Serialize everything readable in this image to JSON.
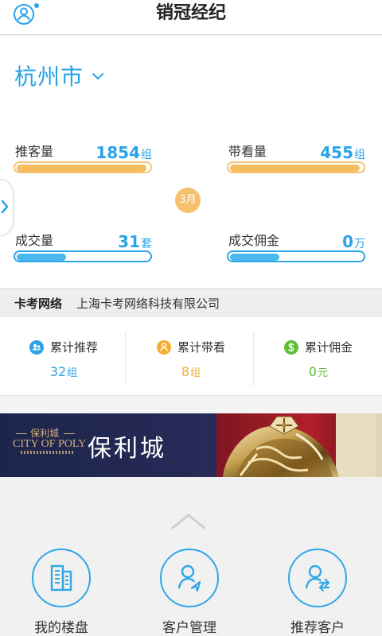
{
  "header": {
    "title": "销冠经纪",
    "profile_icon": "profile-icon",
    "notification_dot_color": "#29a3e8"
  },
  "location": {
    "city": "杭州市",
    "chevron_icon": "chevron-down-icon"
  },
  "stats": [
    {
      "label": "推客量",
      "value": "1854",
      "unit": "组",
      "color": "#f5bd5d",
      "fill_percent": 98
    },
    {
      "label": "带看量",
      "value": "455",
      "unit": "组",
      "color": "#f5bd5d",
      "fill_percent": 98
    },
    {
      "label": "成交量",
      "value": "31",
      "unit": "套",
      "color": "#49b8ee",
      "fill_percent": 39
    },
    {
      "label": "成交佣金",
      "value": "0",
      "unit": "万",
      "color": "#49b8ee",
      "fill_percent": 39
    }
  ],
  "period": {
    "label": "3月"
  },
  "company": {
    "short_name": "卡考网络",
    "full_name": "上海卡考网络科技有限公司"
  },
  "totals": [
    {
      "label": "累计推荐",
      "value": "32",
      "unit": "组",
      "color": "#29a3e8",
      "icon": "referral-icon"
    },
    {
      "label": "累计带看",
      "value": "8",
      "unit": "组",
      "color": "#f5ad2c",
      "icon": "viewing-icon"
    },
    {
      "label": "累计佣金",
      "value": "0",
      "unit": "元",
      "color": "#5dbe35",
      "icon": "commission-icon"
    }
  ],
  "banner": {
    "small_cn": "保利城",
    "english": "CITY OF POLY",
    "title": "保利城",
    "logo_icon": "poly-city-logo-icon"
  },
  "navigation": [
    {
      "label": "我的楼盘",
      "icon": "my-properties-icon"
    },
    {
      "label": "客户管理",
      "icon": "customer-management-icon"
    },
    {
      "label": "推荐客户",
      "icon": "recommend-customer-icon"
    }
  ],
  "collapse_icon": "chevron-up-icon"
}
